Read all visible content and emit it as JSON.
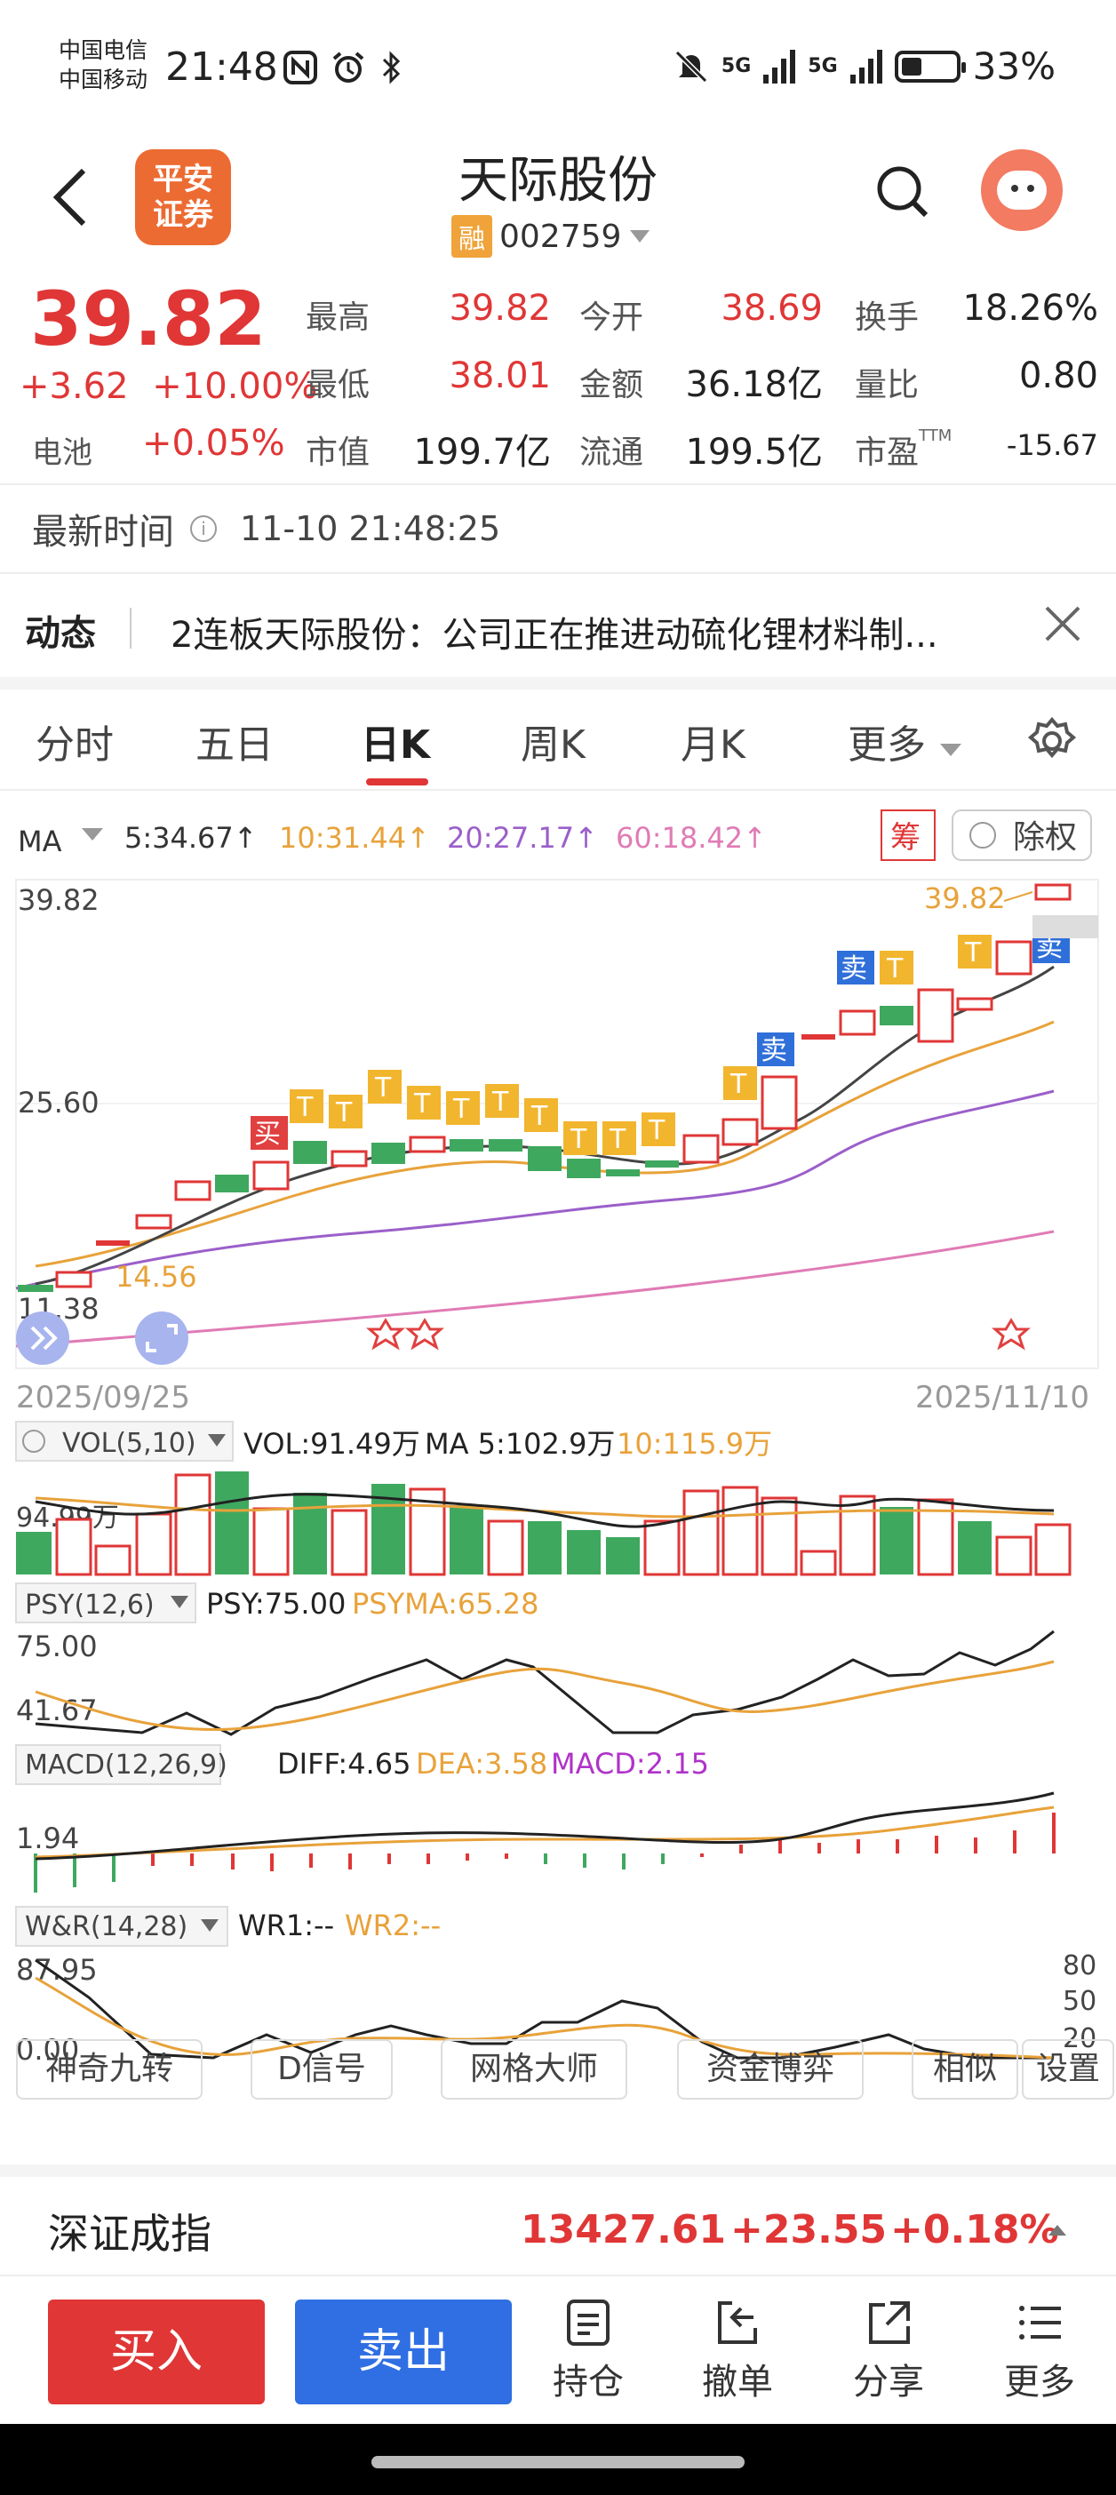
{
  "status": {
    "carrier1": "中国电信",
    "carrier2": "中国移动",
    "time": "21:48",
    "net1": "5G",
    "net2": "5G",
    "battery": "33%"
  },
  "header": {
    "logo_line1": "平安",
    "logo_line2": "证券",
    "title": "天际股份",
    "rong": "融",
    "code": "002759"
  },
  "quote": {
    "price": "39.82",
    "change": "+3.62",
    "change_pct": "+10.00%",
    "battery_label": "电池",
    "battery_change": "+0.05%",
    "high_label": "最高",
    "high": "39.82",
    "open_label": "今开",
    "open": "38.69",
    "turnover_label": "换手",
    "turnover": "18.26%",
    "low_label": "最低",
    "low": "38.01",
    "amount_label": "金额",
    "amount": "36.18亿",
    "volratio_label": "量比",
    "volratio": "0.80",
    "mcap_label": "市值",
    "mcap": "199.7亿",
    "float_label": "流通",
    "float": "199.5亿",
    "pe_label": "市盈",
    "pe_sup": "TTM",
    "pe": "-15.67"
  },
  "latest": {
    "label": "最新时间",
    "time": "11-10 21:48:25"
  },
  "news": {
    "label": "动态",
    "text": "2连板天际股份：公司正在推进动硫化锂材料制..."
  },
  "tabs": [
    "分时",
    "五日",
    "日K",
    "周K",
    "月K",
    "更多"
  ],
  "ma": {
    "label": "MA",
    "ma5": "5:34.67↑",
    "ma10": "10:31.44↑",
    "ma20": "20:27.17↑",
    "ma60": "60:18.42↑",
    "chou": "筹",
    "fuquan": "除权",
    "colors": {
      "ma5": "#333333",
      "ma10": "#e8a23a",
      "ma20": "#9b5fc9",
      "ma60": "#e07bb5"
    }
  },
  "kline": {
    "y_high": "39.82",
    "y_mid": "25.60",
    "y_low": "11.38",
    "max_label": "39.82",
    "min_label": "14.56",
    "date_start": "2025/09/25",
    "date_end": "2025/11/10",
    "sig_buy": "买",
    "sig_sell": "卖",
    "sig_t": "T"
  },
  "vol": {
    "label": "VOL(5,10)",
    "vol": "VOL:91.49万",
    "ma5": "MA 5:102.9万",
    "ma10": "10:115.9万",
    "y": "94.99万"
  },
  "psy": {
    "label": "PSY(12,6)",
    "psy": "PSY:75.00",
    "psyma": "PSYMA:65.28",
    "y1": "75.00",
    "y2": "41.67"
  },
  "macd": {
    "label": "MACD(12,26,9)",
    "diff": "DIFF:4.65",
    "dea": "DEA:3.58",
    "macd": "MACD:2.15",
    "y": "1.94"
  },
  "wr": {
    "label": "W&R(14,28)",
    "wr1": "WR1:--",
    "wr2": "WR2:--",
    "y1": "87.95",
    "y2": "0.00",
    "r1": "80",
    "r2": "50",
    "r3": "20"
  },
  "tools": [
    "神奇九转",
    "D信号",
    "网格大师",
    "资金博弈",
    "相似",
    "设置"
  ],
  "index": {
    "name": "深证成指",
    "value": "13427.61",
    "change": "+23.55",
    "pct": "+0.18%"
  },
  "bottom": {
    "buy": "买入",
    "sell": "卖出",
    "actions": [
      "持仓",
      "撤单",
      "分享",
      "更多"
    ]
  }
}
